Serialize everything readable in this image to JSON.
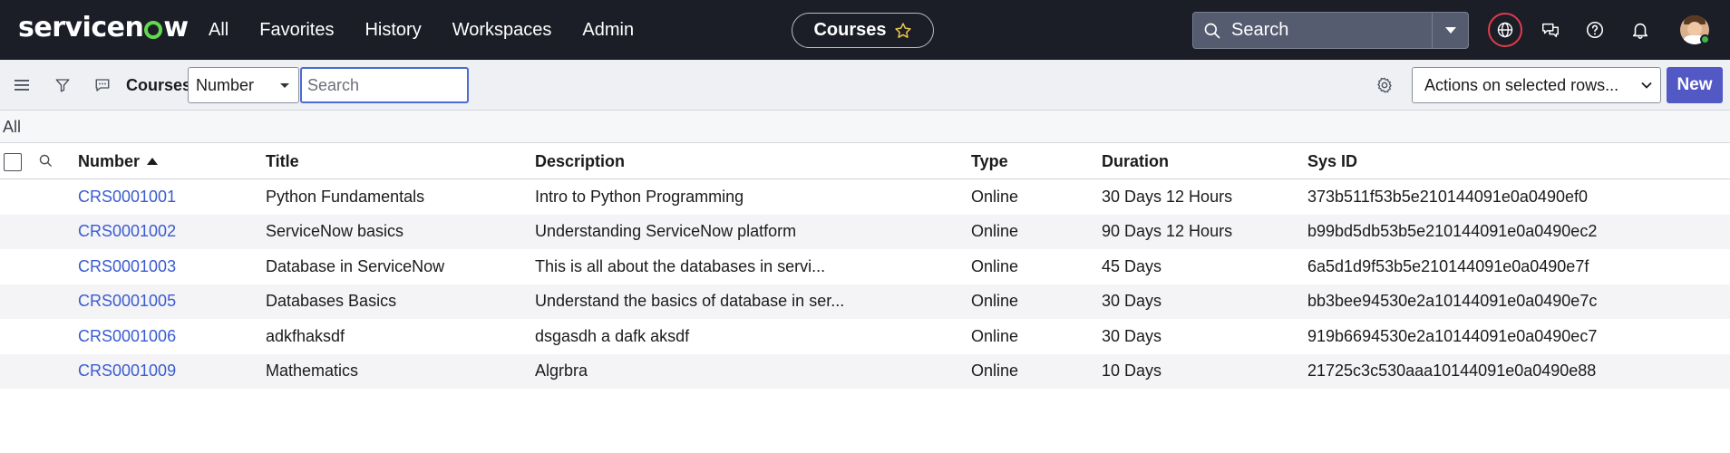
{
  "brand": {
    "logo_text_1": "servicen",
    "logo_text_2": "w"
  },
  "nav": {
    "links": [
      "All",
      "Favorites",
      "History",
      "Workspaces",
      "Admin"
    ],
    "context_pill": "Courses",
    "search_label": "Search",
    "icons": [
      "globe-icon",
      "chat-icon",
      "help-icon",
      "bell-icon",
      "avatar"
    ]
  },
  "toolbar": {
    "title": "Courses",
    "field_select": "Number",
    "search_placeholder": "Search",
    "actions_select": "Actions on selected rows...",
    "new_label": "New"
  },
  "breadcrumb": {
    "label": "All"
  },
  "table": {
    "columns": [
      "Number",
      "Title",
      "Description",
      "Type",
      "Duration",
      "Sys ID"
    ],
    "sort": {
      "column": "Number",
      "direction": "ascending"
    },
    "rows": [
      [
        "CRS0001001",
        "Python Fundamentals",
        "Intro to Python Programming",
        "Online",
        "30 Days 12 Hours",
        "373b511f53b5e210144091e0a0490ef0"
      ],
      [
        "CRS0001002",
        "ServiceNow basics",
        "Understanding ServiceNow platform",
        "Online",
        "90 Days 12 Hours",
        "b99bd5db53b5e210144091e0a0490ec2"
      ],
      [
        "CRS0001003",
        "Database in ServiceNow",
        "This is all about the databases in servi...",
        "Online",
        "45 Days",
        "6a5d1d9f53b5e210144091e0a0490e7f"
      ],
      [
        "CRS0001005",
        "Databases Basics",
        "Understand the basics of database in ser...",
        "Online",
        "30 Days",
        "bb3bee94530e2a10144091e0a0490e7c"
      ],
      [
        "CRS0001006",
        "adkfhaksdf",
        "dsgasdh a dafk aksdf",
        "Online",
        "30 Days",
        "919b6694530e2a10144091e0a0490ec7"
      ],
      [
        "CRS0001009",
        "Mathematics",
        "Algrbra",
        "Online",
        "10 Days",
        "21725c3c530aaa10144091e0a0490e88"
      ]
    ]
  },
  "colors": {
    "nav_bg": "#1b1d27",
    "link": "#3a5bcf",
    "primary_button": "#5259c4",
    "brand_green": "#62d84e",
    "globe_ring": "#e03c4b"
  }
}
